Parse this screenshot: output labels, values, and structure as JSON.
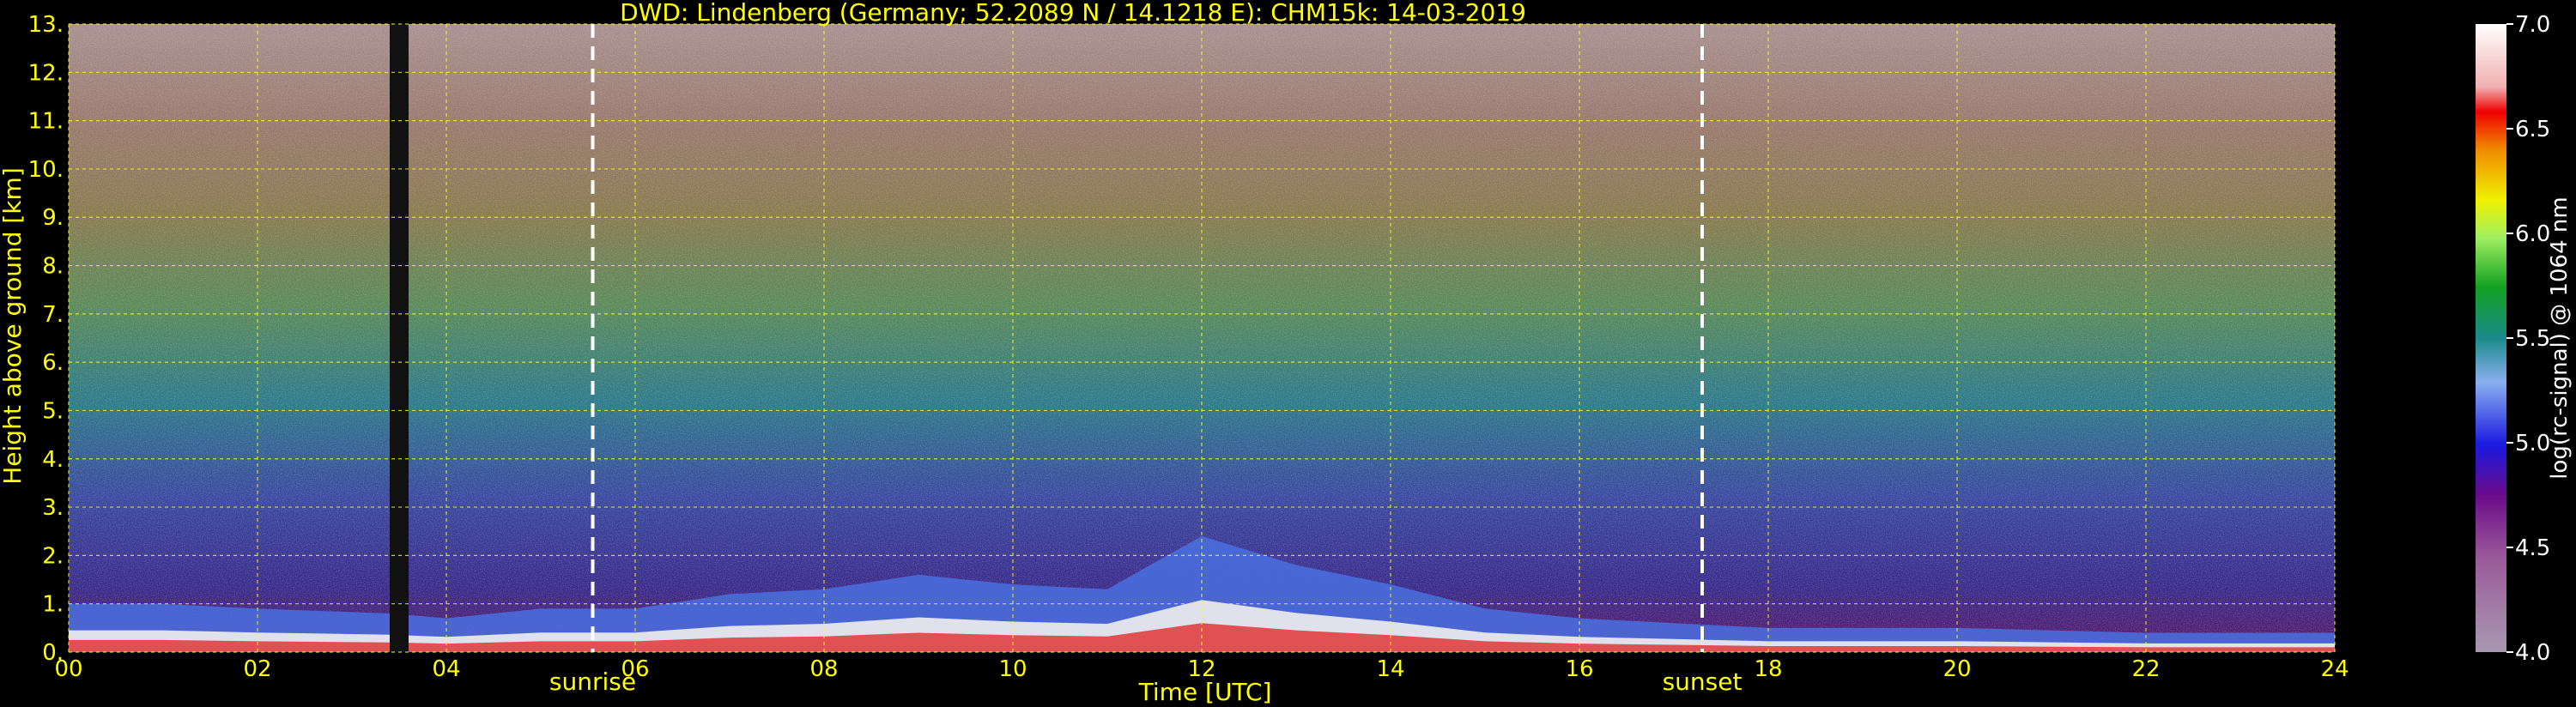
{
  "chart_data": {
    "type": "heatmap",
    "title": "DWD: Lindenberg (Germany; 52.2089 N / 14.1218 E):     CHM15k: 14-03-2019",
    "xlabel": "Time [UTC]",
    "ylabel": "Height above ground [km]",
    "xlim": [
      0,
      24
    ],
    "ylim": [
      0,
      13
    ],
    "x_ticks": [
      "00",
      "02",
      "04",
      "06",
      "08",
      "10",
      "12",
      "14",
      "16",
      "18",
      "20",
      "22",
      "24"
    ],
    "y_ticks": [
      "0.",
      "1.",
      "2.",
      "3.",
      "4.",
      "5.",
      "6.",
      "7.",
      "8.",
      "9.",
      "10.",
      "11.",
      "12.",
      "13."
    ],
    "grid": true,
    "annotations": [
      {
        "label": "sunrise",
        "time": 5.55
      },
      {
        "label": "sunset",
        "time": 17.3
      }
    ],
    "colorbar": {
      "label": "log(rc-signal) @ 1064 nm",
      "range": [
        4.0,
        7.0
      ],
      "ticks": [
        "4.0",
        "4.5",
        "5.0",
        "5.5",
        "6.0",
        "6.5",
        "7.0"
      ]
    },
    "data_gap": [
      3.4,
      3.6
    ],
    "boundary_layer_top_km": [
      {
        "time": 0,
        "height": 1.0
      },
      {
        "time": 1,
        "height": 1.0
      },
      {
        "time": 2,
        "height": 0.9
      },
      {
        "time": 3.4,
        "height": 0.8
      },
      {
        "time": 4,
        "height": 0.7
      },
      {
        "time": 5,
        "height": 0.9
      },
      {
        "time": 6,
        "height": 0.9
      },
      {
        "time": 7,
        "height": 1.2
      },
      {
        "time": 8,
        "height": 1.3
      },
      {
        "time": 9,
        "height": 1.6
      },
      {
        "time": 10,
        "height": 1.4
      },
      {
        "time": 11,
        "height": 1.3
      },
      {
        "time": 12,
        "height": 2.4
      },
      {
        "time": 13,
        "height": 1.8
      },
      {
        "time": 14,
        "height": 1.4
      },
      {
        "time": 15,
        "height": 0.9
      },
      {
        "time": 16,
        "height": 0.7
      },
      {
        "time": 17,
        "height": 0.6
      },
      {
        "time": 18,
        "height": 0.5
      },
      {
        "time": 20,
        "height": 0.5
      },
      {
        "time": 22,
        "height": 0.4
      },
      {
        "time": 24,
        "height": 0.4
      }
    ]
  }
}
